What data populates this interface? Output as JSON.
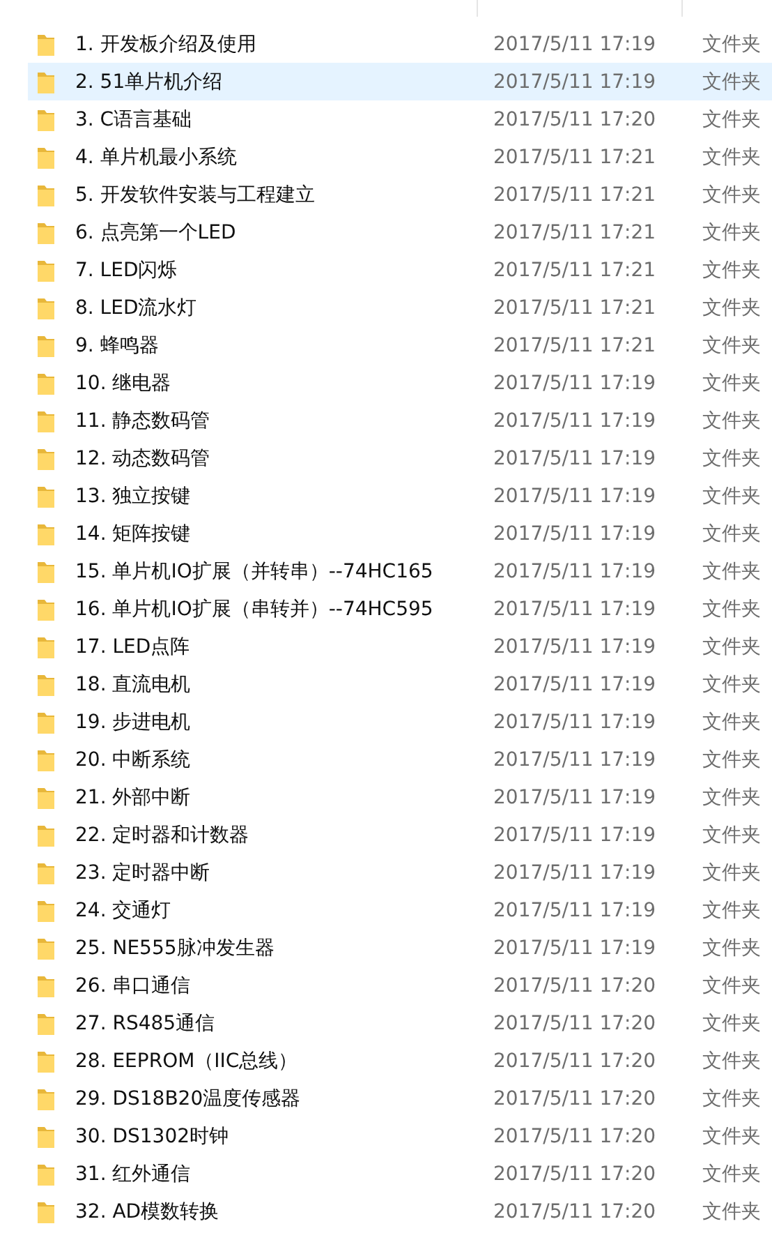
{
  "rows": [
    {
      "name": "1. 开发板介绍及使用",
      "date": "2017/5/11 17:19",
      "type": "文件夹",
      "selected": false
    },
    {
      "name": "2. 51单片机介绍",
      "date": "2017/5/11 17:19",
      "type": "文件夹",
      "selected": true
    },
    {
      "name": "3. C语言基础",
      "date": "2017/5/11 17:20",
      "type": "文件夹",
      "selected": false
    },
    {
      "name": "4. 单片机最小系统",
      "date": "2017/5/11 17:21",
      "type": "文件夹",
      "selected": false
    },
    {
      "name": "5. 开发软件安装与工程建立",
      "date": "2017/5/11 17:21",
      "type": "文件夹",
      "selected": false
    },
    {
      "name": "6. 点亮第一个LED",
      "date": "2017/5/11 17:21",
      "type": "文件夹",
      "selected": false
    },
    {
      "name": "7. LED闪烁",
      "date": "2017/5/11 17:21",
      "type": "文件夹",
      "selected": false
    },
    {
      "name": "8. LED流水灯",
      "date": "2017/5/11 17:21",
      "type": "文件夹",
      "selected": false
    },
    {
      "name": "9. 蜂鸣器",
      "date": "2017/5/11 17:21",
      "type": "文件夹",
      "selected": false
    },
    {
      "name": "10. 继电器",
      "date": "2017/5/11 17:19",
      "type": "文件夹",
      "selected": false
    },
    {
      "name": "11. 静态数码管",
      "date": "2017/5/11 17:19",
      "type": "文件夹",
      "selected": false
    },
    {
      "name": "12. 动态数码管",
      "date": "2017/5/11 17:19",
      "type": "文件夹",
      "selected": false
    },
    {
      "name": "13. 独立按键",
      "date": "2017/5/11 17:19",
      "type": "文件夹",
      "selected": false
    },
    {
      "name": "14. 矩阵按键",
      "date": "2017/5/11 17:19",
      "type": "文件夹",
      "selected": false
    },
    {
      "name": "15. 单片机IO扩展（并转串）--74HC165",
      "date": "2017/5/11 17:19",
      "type": "文件夹",
      "selected": false
    },
    {
      "name": "16. 单片机IO扩展（串转并）--74HC595",
      "date": "2017/5/11 17:19",
      "type": "文件夹",
      "selected": false
    },
    {
      "name": "17. LED点阵",
      "date": "2017/5/11 17:19",
      "type": "文件夹",
      "selected": false
    },
    {
      "name": "18. 直流电机",
      "date": "2017/5/11 17:19",
      "type": "文件夹",
      "selected": false
    },
    {
      "name": "19. 步进电机",
      "date": "2017/5/11 17:19",
      "type": "文件夹",
      "selected": false
    },
    {
      "name": "20. 中断系统",
      "date": "2017/5/11 17:19",
      "type": "文件夹",
      "selected": false
    },
    {
      "name": "21. 外部中断",
      "date": "2017/5/11 17:19",
      "type": "文件夹",
      "selected": false
    },
    {
      "name": "22. 定时器和计数器",
      "date": "2017/5/11 17:19",
      "type": "文件夹",
      "selected": false
    },
    {
      "name": "23. 定时器中断",
      "date": "2017/5/11 17:19",
      "type": "文件夹",
      "selected": false
    },
    {
      "name": "24. 交通灯",
      "date": "2017/5/11 17:19",
      "type": "文件夹",
      "selected": false
    },
    {
      "name": "25. NE555脉冲发生器",
      "date": "2017/5/11 17:19",
      "type": "文件夹",
      "selected": false
    },
    {
      "name": "26. 串口通信",
      "date": "2017/5/11 17:20",
      "type": "文件夹",
      "selected": false
    },
    {
      "name": "27. RS485通信",
      "date": "2017/5/11 17:20",
      "type": "文件夹",
      "selected": false
    },
    {
      "name": "28. EEPROM（IIC总线）",
      "date": "2017/5/11 17:20",
      "type": "文件夹",
      "selected": false
    },
    {
      "name": "29. DS18B20温度传感器",
      "date": "2017/5/11 17:20",
      "type": "文件夹",
      "selected": false
    },
    {
      "name": "30. DS1302时钟",
      "date": "2017/5/11 17:20",
      "type": "文件夹",
      "selected": false
    },
    {
      "name": "31. 红外通信",
      "date": "2017/5/11 17:20",
      "type": "文件夹",
      "selected": false
    },
    {
      "name": "32. AD模数转换",
      "date": "2017/5/11 17:20",
      "type": "文件夹",
      "selected": false
    }
  ]
}
